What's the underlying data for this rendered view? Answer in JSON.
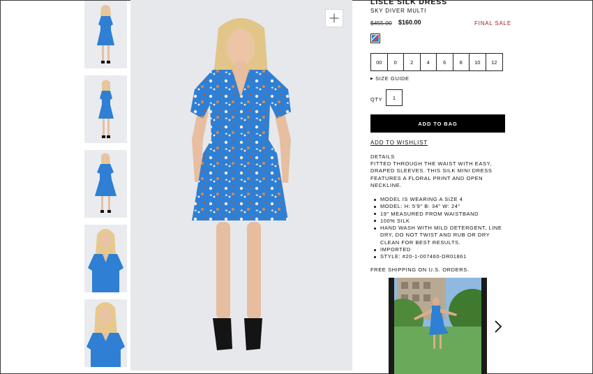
{
  "product": {
    "title": "LISLE SILK DRESS",
    "color_name": "SKY DIVER MULTI",
    "price_original": "$455.00",
    "price_sale": "$160.00",
    "sale_badge": "FINAL SALE"
  },
  "sizes": [
    "00",
    "0",
    "2",
    "4",
    "6",
    "8",
    "10",
    "12"
  ],
  "size_guide_label": "SIZE GUIDE",
  "quantity": {
    "label": "QTY",
    "value": "1"
  },
  "add_to_bag_label": "ADD TO BAG",
  "wishlist_label": "ADD TO WISHLIST",
  "details": {
    "heading": "DETAILS",
    "description": "FITTED THROUGH THE WAIST WITH EASY, DRAPED SLEEVES. THIS SILK MINI DRESS FEATURES A FLORAL PRINT AND OPEN NECKLINE.",
    "bullets": [
      "MODEL IS WEARING A SIZE 4",
      "MODEL: H: 5'9\" B: 34\" W: 24\"",
      "19\" MEASURED FROM WAISTBAND",
      "100% SILK",
      "HAND WASH WITH MILD DETERGENT, LINE DRY, DO NOT TWIST AND RUB OR DRY CLEAN FOR BEST RESULTS.",
      "IMPORTED",
      "STYLE: #20-1-007460-DR01861"
    ]
  },
  "shipping_note": "FREE SHIPPING ON U.S. ORDERS.",
  "colors": {
    "dress": "#2f7fd4",
    "sale_red": "#9b1b1b",
    "button_bg": "#000000"
  },
  "icons": {
    "zoom": "plus-icon",
    "next": "chevron-right-icon",
    "size_guide": "triangle-right-icon"
  }
}
